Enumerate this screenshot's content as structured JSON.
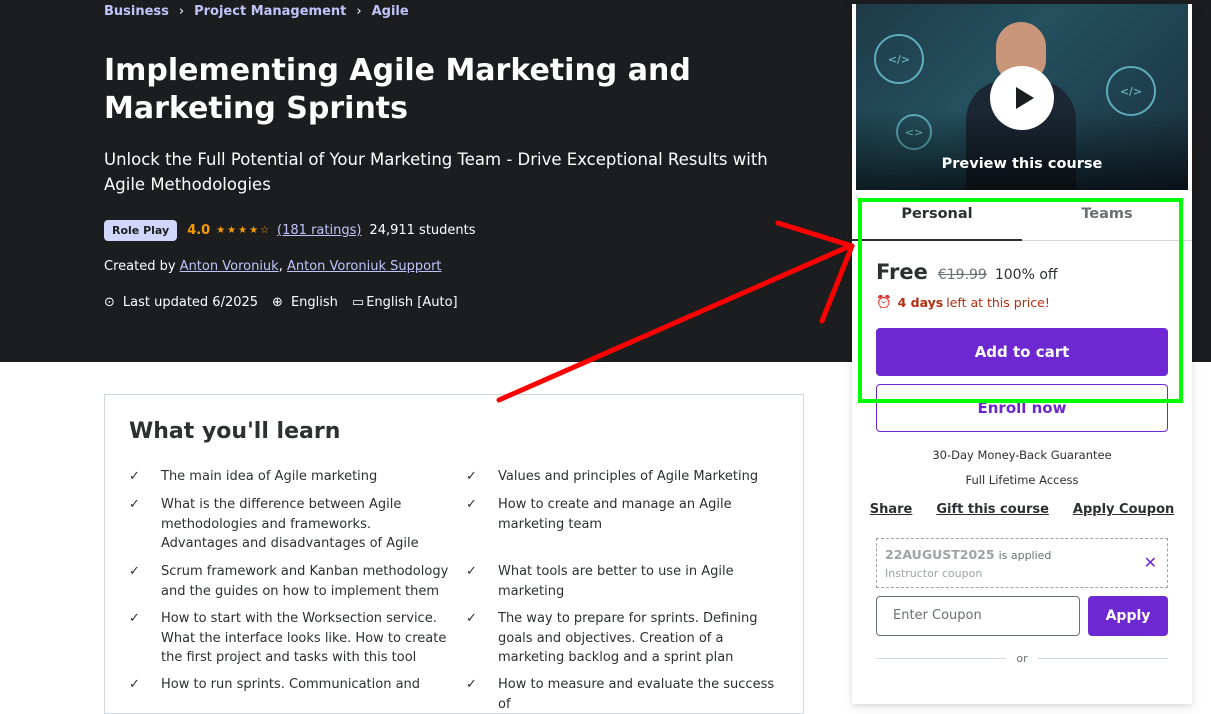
{
  "breadcrumb": [
    "Business",
    "Project Management",
    "Agile"
  ],
  "course": {
    "title": "Implementing Agile Marketing and Marketing Sprints",
    "subtitle": "Unlock the Full Potential of Your Marketing Team - Drive Exceptional Results with Agile Methodologies",
    "badge": "Role Play",
    "rating": "4.0",
    "ratings_count": "(181 ratings)",
    "students": "24,911 students",
    "created_by_label": "Created by",
    "instructors": [
      "Anton Voroniuk",
      "Anton Voroniuk Support"
    ],
    "last_updated": "Last updated 6/2025",
    "language": "English",
    "captions": "English [Auto]"
  },
  "learn": {
    "title": "What you'll learn",
    "left": [
      "The main idea of Agile marketing",
      "What is the difference between Agile methodologies and frameworks. Advantages and disadvantages of Agile",
      "Scrum framework and Kanban methodology and the guides on how to implement them",
      "How to start with the Worksection service. What the interface looks like. How to create the first project and tasks with this tool",
      "How to run sprints. Communication and"
    ],
    "right": [
      "Values and principles of Agile Marketing",
      "How to create and manage an Agile marketing team",
      "What tools are better to use in Agile marketing",
      "The way to prepare for sprints. Defining goals and objectives. Creation of a marketing backlog and a sprint plan",
      "How to measure and evaluate the success of"
    ]
  },
  "sidebar": {
    "preview_label": "Preview this course",
    "tabs": [
      "Personal",
      "Teams"
    ],
    "price": "Free",
    "old_price": "€19.99",
    "discount": "100% off",
    "timer_bold": "4 days",
    "timer_rest": "left at this price!",
    "add_to_cart": "Add to cart",
    "enroll_now": "Enroll now",
    "guarantee": "30-Day Money-Back Guarantee",
    "lifetime": "Full Lifetime Access",
    "links": [
      "Share",
      "Gift this course",
      "Apply Coupon"
    ],
    "coupon_code": "22AUGUST2025",
    "coupon_applied": "is applied",
    "coupon_sub": "Instructor coupon",
    "coupon_placeholder": "Enter Coupon",
    "apply": "Apply",
    "or": "or"
  },
  "colors": {
    "hero_bg": "#1c1d1f",
    "accent": "#6d28d2",
    "link": "#c0c4fc",
    "star": "#f69c08",
    "annotation_box": "#00ff00",
    "annotation_arrow": "#ff0000"
  }
}
